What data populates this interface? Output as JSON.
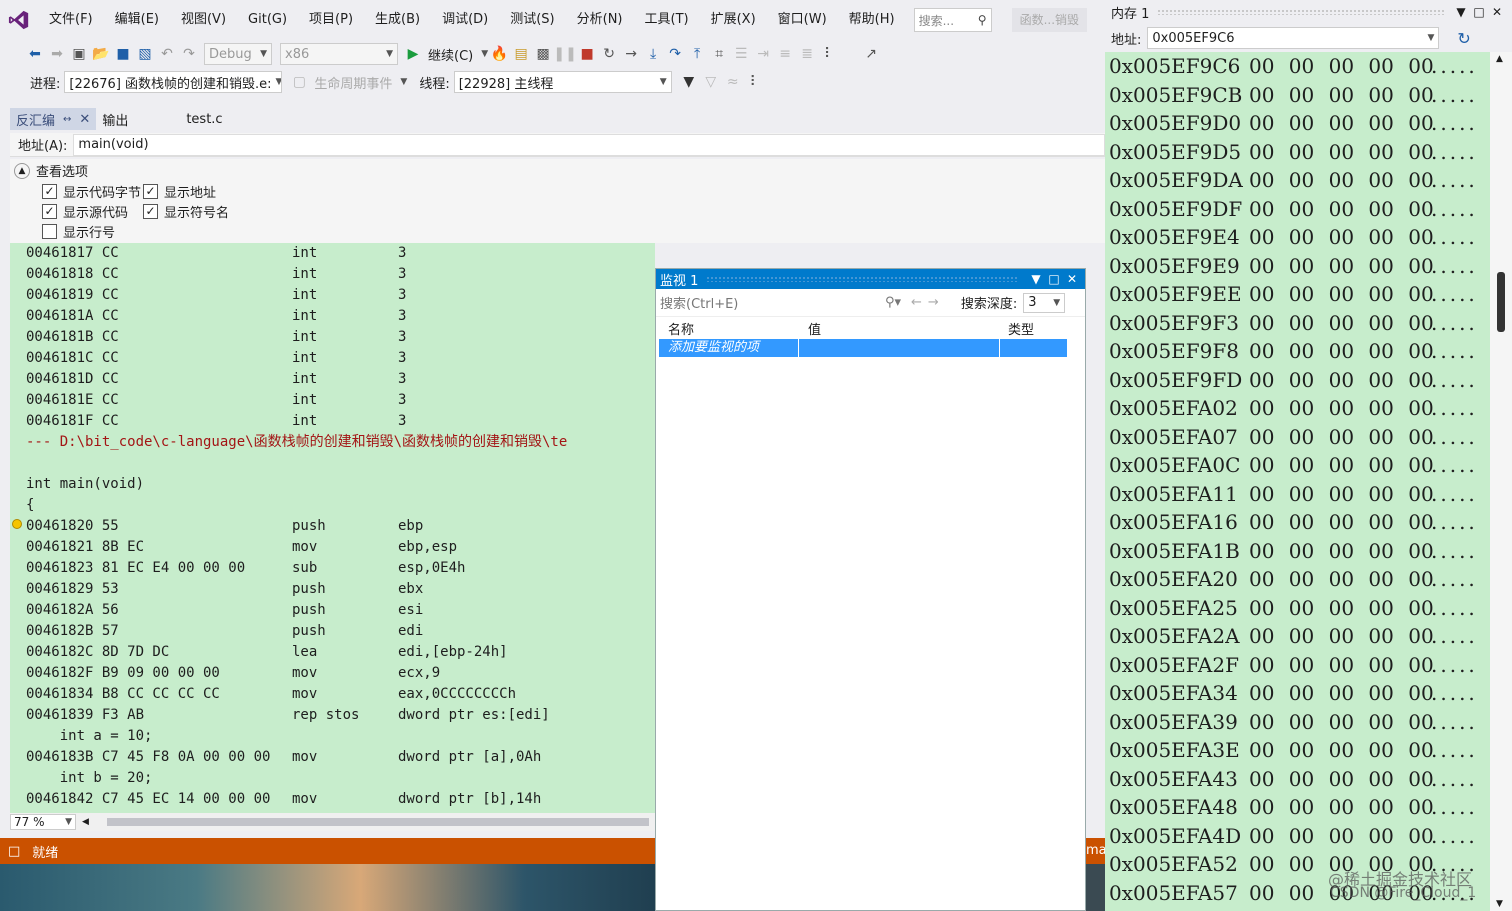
{
  "menubar": {
    "items": [
      "文件(F)",
      "编辑(E)",
      "视图(V)",
      "Git(G)",
      "项目(P)",
      "生成(B)",
      "调试(D)",
      "测试(S)",
      "分析(N)",
      "工具(T)",
      "扩展(X)",
      "窗口(W)",
      "帮助(H)"
    ],
    "search_placeholder": "搜索...",
    "title_badge": "函数...销毁"
  },
  "toolbar": {
    "config": "Debug",
    "platform": "x86",
    "continue_label": "继续(C)"
  },
  "procbar": {
    "process_label": "进程:",
    "process_value": "[22676] 函数栈帧的创建和销毁.e:",
    "lifecycle_label": "生命周期事件",
    "thread_label": "线程:",
    "thread_value": "[22928] 主线程"
  },
  "tabs": {
    "disasm": "反汇编",
    "output": "输出",
    "file": "test.c"
  },
  "address": {
    "label": "地址(A):",
    "value": "main(void)"
  },
  "options": {
    "header": "查看选项",
    "show_code_bytes": "显示代码字节",
    "show_address": "显示地址",
    "show_source": "显示源代码",
    "show_symbols": "显示符号名",
    "show_line_numbers": "显示行号"
  },
  "code_lines": [
    {
      "addr": "00461817 CC",
      "mn": "int",
      "op": "3"
    },
    {
      "addr": "00461818 CC",
      "mn": "int",
      "op": "3"
    },
    {
      "addr": "00461819 CC",
      "mn": "int",
      "op": "3"
    },
    {
      "addr": "0046181A CC",
      "mn": "int",
      "op": "3"
    },
    {
      "addr": "0046181B CC",
      "mn": "int",
      "op": "3"
    },
    {
      "addr": "0046181C CC",
      "mn": "int",
      "op": "3"
    },
    {
      "addr": "0046181D CC",
      "mn": "int",
      "op": "3"
    },
    {
      "addr": "0046181E CC",
      "mn": "int",
      "op": "3"
    },
    {
      "addr": "0046181F CC",
      "mn": "int",
      "op": "3"
    },
    {
      "path": "--- D:\\bit_code\\c-language\\函数栈帧的创建和销毁\\函数栈帧的创建和销毁\\te"
    },
    {
      "src": ""
    },
    {
      "src": "int main(void)"
    },
    {
      "src": "{"
    },
    {
      "addr": "00461820 55",
      "mn": "push",
      "op": "ebp"
    },
    {
      "addr": "00461821 8B EC",
      "mn": "mov",
      "op": "ebp,esp"
    },
    {
      "addr": "00461823 81 EC E4 00 00 00",
      "mn": "sub",
      "op": "esp,0E4h"
    },
    {
      "addr": "00461829 53",
      "mn": "push",
      "op": "ebx"
    },
    {
      "addr": "0046182A 56",
      "mn": "push",
      "op": "esi"
    },
    {
      "addr": "0046182B 57",
      "mn": "push",
      "op": "edi"
    },
    {
      "addr": "0046182C 8D 7D DC",
      "mn": "lea",
      "op": "edi,[ebp-24h]"
    },
    {
      "addr": "0046182F B9 09 00 00 00",
      "mn": "mov",
      "op": "ecx,9"
    },
    {
      "addr": "00461834 B8 CC CC CC CC",
      "mn": "mov",
      "op": "eax,0CCCCCCCCh"
    },
    {
      "addr": "00461839 F3 AB",
      "mn": "rep stos",
      "op": "dword ptr es:[edi]"
    },
    {
      "src": "    int a = 10;"
    },
    {
      "addr": "0046183B C7 45 F8 0A 00 00 00",
      "mn": "mov",
      "op": "dword ptr [a],0Ah"
    },
    {
      "src": "    int b = 20;"
    },
    {
      "addr": "00461842 C7 45 EC 14 00 00 00",
      "mn": "mov",
      "op": "dword ptr [b],14h"
    }
  ],
  "zoom": "77 %",
  "status": {
    "text": "就绪",
    "right_fragment": "ma"
  },
  "watch": {
    "title": "监视 1",
    "search_placeholder": "搜索(Ctrl+E)",
    "depth_label": "搜索深度:",
    "depth_value": "3",
    "col_name": "名称",
    "col_value": "值",
    "col_type": "类型",
    "add_item": "添加要监视的项"
  },
  "memory": {
    "title": "内存 1",
    "address_label": "地址:",
    "address_value": "0x005EF9C6",
    "rows": [
      "0x005EF9C6",
      "0x005EF9CB",
      "0x005EF9D0",
      "0x005EF9D5",
      "0x005EF9DA",
      "0x005EF9DF",
      "0x005EF9E4",
      "0x005EF9E9",
      "0x005EF9EE",
      "0x005EF9F3",
      "0x005EF9F8",
      "0x005EF9FD",
      "0x005EFA02",
      "0x005EFA07",
      "0x005EFA0C",
      "0x005EFA11",
      "0x005EFA16",
      "0x005EFA1B",
      "0x005EFA20",
      "0x005EFA25",
      "0x005EFA2A",
      "0x005EFA2F",
      "0x005EFA34",
      "0x005EFA39",
      "0x005EFA3E",
      "0x005EFA43",
      "0x005EFA48",
      "0x005EFA4D",
      "0x005EFA52",
      "0x005EFA57"
    ],
    "bytes": "00 00 00 00 00",
    "chars": "....."
  },
  "watermarks": [
    "@稀土掘金技术社区",
    "CSDN @Fire_Cloud_1"
  ],
  "colors": {
    "accent": "#007acc",
    "status": "#ca5100",
    "code_bg": "#c7edcc",
    "selection": "#3399ff"
  }
}
